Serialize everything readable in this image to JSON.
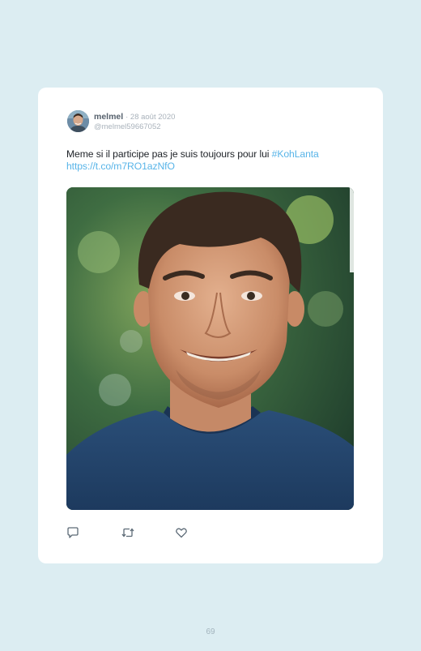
{
  "tweet": {
    "display_name": "melmel",
    "date": "· 28 août 2020",
    "handle": "@melmel59667052",
    "text": "Meme si il participe pas je suis toujours pour lui ",
    "hashtag": "#KohLanta",
    "link": "https://t.co/m7RO1azNfO",
    "photo_description_icon": "portrait-photo"
  },
  "actions": {
    "reply_icon": "reply-icon",
    "retweet_icon": "retweet-icon",
    "like_icon": "heart-icon"
  },
  "page": {
    "number": "69"
  },
  "colors": {
    "background": "#dcedf2",
    "card": "#ffffff",
    "link": "#58b4e8",
    "muted": "#a9b2bb"
  }
}
